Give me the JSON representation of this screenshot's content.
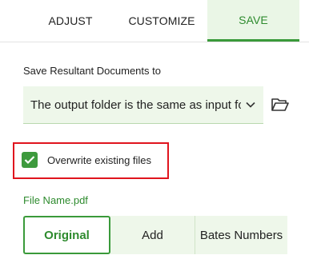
{
  "tabs": {
    "adjust": "ADJUST",
    "customize": "CUSTOMIZE",
    "save": "SAVE",
    "active": "SAVE"
  },
  "save_location": {
    "label": "Save Resultant Documents to",
    "selected": "The output folder is the same as input folder",
    "browse_icon": "folder-open-icon"
  },
  "overwrite": {
    "label": "Overwrite existing files",
    "checked": true
  },
  "file_name": {
    "preview": "File Name.pdf",
    "options": [
      "Original",
      "Add",
      "Bates Numbers"
    ],
    "selected": "Original"
  },
  "colors": {
    "accent": "#3a9a3a",
    "accent_bg": "#eaf6e6",
    "highlight": "#e0141e"
  }
}
